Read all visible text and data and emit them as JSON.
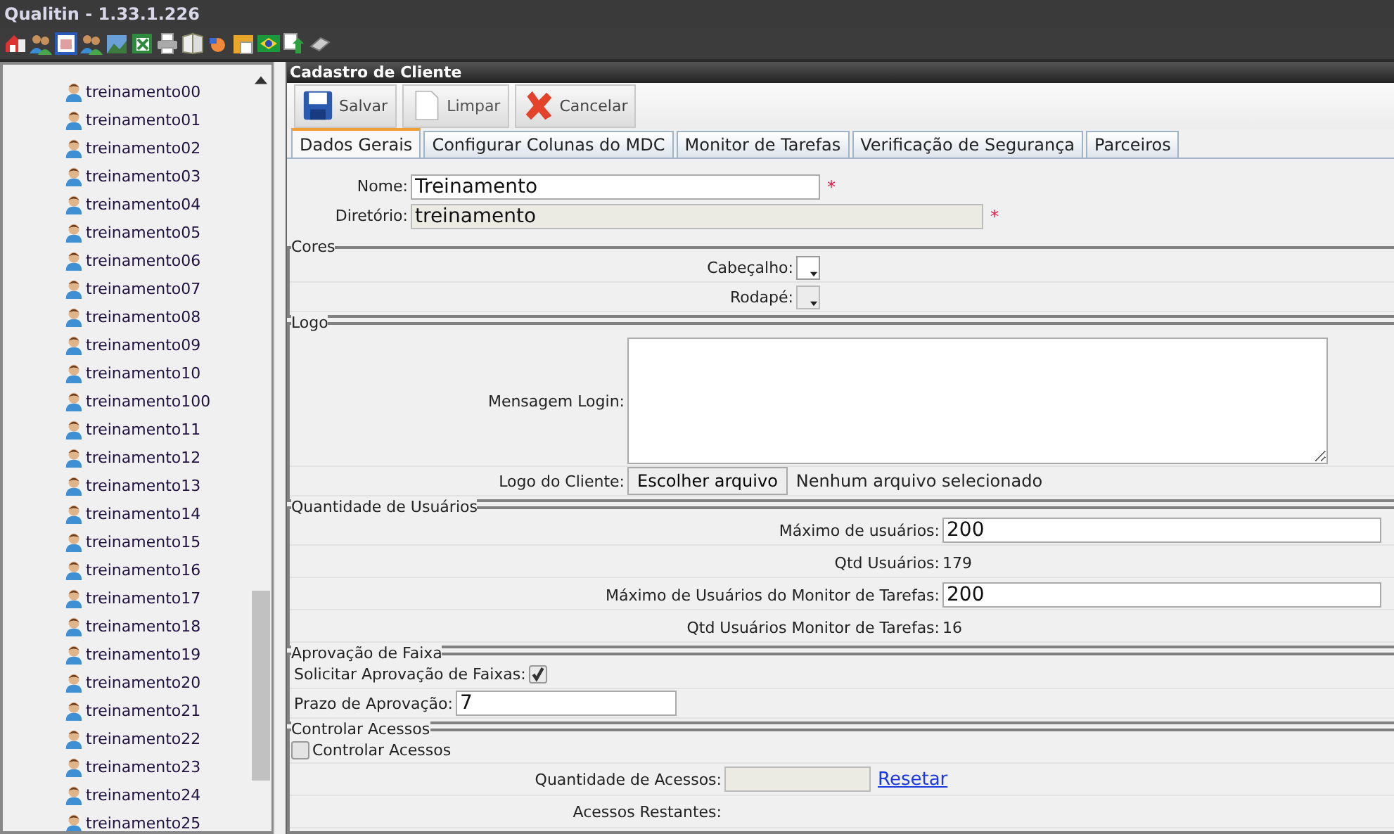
{
  "window": {
    "title": "Qualitin - 1.33.1.226"
  },
  "sidebar": {
    "items": [
      {
        "label": "treinamento00"
      },
      {
        "label": "treinamento01"
      },
      {
        "label": "treinamento02"
      },
      {
        "label": "treinamento03"
      },
      {
        "label": "treinamento04"
      },
      {
        "label": "treinamento05"
      },
      {
        "label": "treinamento06"
      },
      {
        "label": "treinamento07"
      },
      {
        "label": "treinamento08"
      },
      {
        "label": "treinamento09"
      },
      {
        "label": "treinamento10"
      },
      {
        "label": "treinamento100"
      },
      {
        "label": "treinamento11"
      },
      {
        "label": "treinamento12"
      },
      {
        "label": "treinamento13"
      },
      {
        "label": "treinamento14"
      },
      {
        "label": "treinamento15"
      },
      {
        "label": "treinamento16"
      },
      {
        "label": "treinamento17"
      },
      {
        "label": "treinamento18"
      },
      {
        "label": "treinamento19"
      },
      {
        "label": "treinamento20"
      },
      {
        "label": "treinamento21"
      },
      {
        "label": "treinamento22"
      },
      {
        "label": "treinamento23"
      },
      {
        "label": "treinamento24"
      },
      {
        "label": "treinamento25"
      }
    ]
  },
  "panel": {
    "title": "Cadastro de Cliente",
    "buttons": [
      {
        "label": "Salvar",
        "kind": "save"
      },
      {
        "label": "Limpar",
        "kind": "clear"
      },
      {
        "label": "Cancelar",
        "kind": "cancel"
      }
    ],
    "tabs": [
      {
        "label": "Dados Gerais",
        "selected": true
      },
      {
        "label": "Configurar Colunas do MDC",
        "selected": false
      },
      {
        "label": "Monitor de Tarefas",
        "selected": false
      },
      {
        "label": "Verificação de Segurança",
        "selected": false
      },
      {
        "label": "Parceiros",
        "selected": false
      }
    ],
    "fields": [
      {
        "label": "Nome:",
        "value": "Treinamento",
        "disabled": false,
        "mark": "*"
      },
      {
        "label": "Diretório:",
        "value": "treinamento",
        "disabled": true,
        "mark": "*"
      }
    ],
    "cores": {
      "legend": "Cores",
      "rows": [
        {
          "label": "Cabeçalho:",
          "disabled": false
        },
        {
          "label": "Rodapé:",
          "disabled": true
        }
      ]
    },
    "logo": {
      "legend": "Logo",
      "message_label": "Mensagem Login:",
      "file_label": "Logo do Cliente:",
      "file_button": "Escolher arquivo",
      "file_status": "Nenhum arquivo selecionado"
    },
    "usuarios": {
      "legend": "Quantidade de Usuários",
      "rows": [
        {
          "kind": "input",
          "label": "Máximo de usuários:",
          "value": "200"
        },
        {
          "kind": "text",
          "label": "Qtd Usuários:",
          "value": "179"
        },
        {
          "kind": "input",
          "label": "Máximo de Usuários do Monitor de Tarefas:",
          "value": "200"
        },
        {
          "kind": "text",
          "label": "Qtd Usuários Monitor de Tarefas:",
          "value": "16"
        }
      ]
    },
    "aprovacao": {
      "legend": "Aprovação de Faixa",
      "checkbox": {
        "label": "Solicitar Aprovação de Faixas:",
        "checked": true
      },
      "prazo": {
        "label": "Prazo de Aprovação:",
        "value": "7"
      }
    },
    "acessos": {
      "legend": "Controlar Acessos",
      "checkbox": {
        "label": "Controlar Acessos",
        "checked": false
      },
      "quantidade": {
        "label": "Quantidade de Acessos:",
        "disabled": true
      },
      "link": "Resetar",
      "restantes_label": "Acessos Restantes:"
    }
  }
}
